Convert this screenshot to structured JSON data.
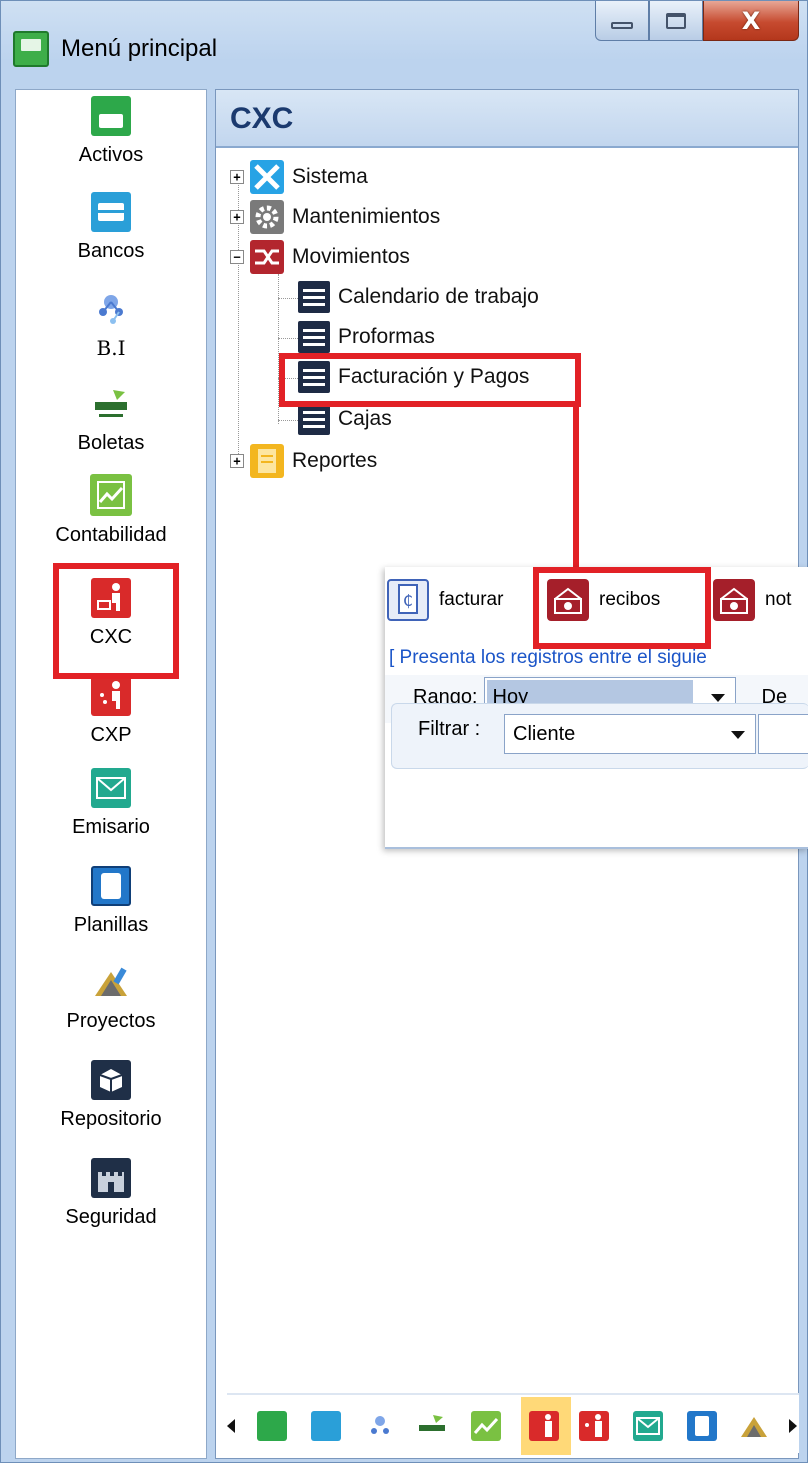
{
  "window": {
    "title": "Menú principal",
    "controls": {
      "minimize": "",
      "maximize": "",
      "close": "X"
    }
  },
  "sidebar": {
    "items": [
      {
        "label": "Activos",
        "icon": "cash-register-icon",
        "color": "#2da84a"
      },
      {
        "label": "Bancos",
        "icon": "briefcase-icon",
        "color": "#2a9fd8"
      },
      {
        "label": "B.I",
        "icon": "network-brain-icon",
        "color": "#4b7ad0"
      },
      {
        "label": "Boletas",
        "icon": "fusion-logo-icon",
        "color": "#2c6f2e"
      },
      {
        "label": "Contabilidad",
        "icon": "chart-line-icon",
        "color": "#7ac142"
      },
      {
        "label": "CXC",
        "icon": "person-money-icon",
        "color": "#d92a2a"
      },
      {
        "label": "CXP",
        "icon": "person-pay-icon",
        "color": "#d92a2a"
      },
      {
        "label": "Emisario",
        "icon": "envelope-icon",
        "color": "#22a98f"
      },
      {
        "label": "Planillas",
        "icon": "document-icon",
        "color": "#2277c9"
      },
      {
        "label": "Proyectos",
        "icon": "tools-icon",
        "color": "#c9a23a"
      },
      {
        "label": "Repositorio",
        "icon": "box-icon",
        "color": "#1f2f47"
      },
      {
        "label": "Seguridad",
        "icon": "castle-icon",
        "color": "#1f2f47"
      }
    ],
    "selected": "CXC"
  },
  "main": {
    "title": "CXC",
    "tree": {
      "nodes": [
        {
          "label": "Sistema",
          "icon": "tools-icon",
          "color": "#27a3e5",
          "expander": "+"
        },
        {
          "label": "Mantenimientos",
          "icon": "gear-icon",
          "color": "#7a7a7a",
          "expander": "+"
        },
        {
          "label": "Movimientos",
          "icon": "shuffle-icon",
          "color": "#b3262e",
          "expander": "−"
        },
        {
          "label": "Calendario de trabajo",
          "icon": "list-icon"
        },
        {
          "label": "Proformas",
          "icon": "list-icon"
        },
        {
          "label": "Facturación y Pagos",
          "icon": "list-icon"
        },
        {
          "label": "Cajas",
          "icon": "list-icon"
        },
        {
          "label": "Reportes",
          "icon": "report-icon",
          "color": "#f3b61f",
          "expander": "+"
        }
      ]
    }
  },
  "popup": {
    "toolbar": [
      {
        "label": "facturar",
        "icon": "invoice-icon",
        "color": "#3f63b8"
      },
      {
        "label": "recibos",
        "icon": "cash-icon",
        "color": "#a51f2a"
      },
      {
        "label": "not",
        "icon": "cash-icon",
        "color": "#a51f2a"
      }
    ],
    "info_text": "[ Presenta los registros entre el siguie",
    "range_label": "Rango:",
    "range_value": "Hoy",
    "range_suffix": "De",
    "filter_label": "Filtrar :",
    "filter_value": "Cliente"
  },
  "bottom_strip": {
    "icons": [
      "cash-register-icon",
      "briefcase-icon",
      "network-brain-icon",
      "fusion-logo-icon",
      "chart-line-icon",
      "person-money-icon",
      "person-pay-icon",
      "envelope-icon",
      "document-icon",
      "tools-icon"
    ],
    "active": "person-money-icon"
  },
  "colors": {
    "highlight": "#e22126",
    "accent_blue": "#1b3a6e",
    "link_blue": "#1b55c8"
  }
}
